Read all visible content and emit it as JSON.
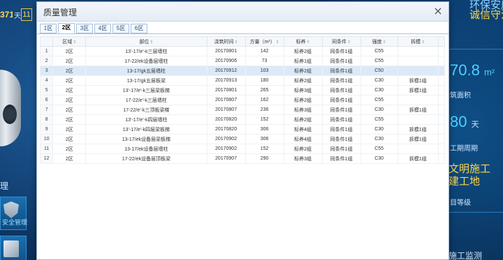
{
  "background": {
    "counter": "371",
    "day_unit": "天",
    "day_box": "11",
    "left_label": "理",
    "tile_caption": "安全管理",
    "right_title_1": "环保安康",
    "right_title_2": "诚信守法",
    "right_area_value": "70.8",
    "right_area_unit": "m²",
    "right_area_caption": "筑面积",
    "right_days_value": "80",
    "right_days_unit": "天",
    "right_days_caption": "工期周期",
    "right_civ": "文明施工\n建工地",
    "right_grade": "目等级",
    "right_monitor": "施工监测"
  },
  "modal": {
    "title": "质量管理",
    "close_label": "×",
    "tabs": [
      "1区",
      "2区",
      "3区",
      "4区",
      "5区",
      "6区"
    ],
    "active_tab": 1
  },
  "table": {
    "columns": [
      "区域",
      "部位",
      "浇筑时间",
      "方量（m³）",
      "标养",
      "同条件",
      "强度",
      "拆模"
    ],
    "rows": [
      [
        "1",
        "2区",
        "13'-17/e'-k三层墙柱",
        "20170801",
        "142",
        "标养2组",
        "同条件1组",
        "C55",
        ""
      ],
      [
        "2",
        "2区",
        "17-22/ek设备层墙柱",
        "20170906",
        "73",
        "标养1组",
        "同条件1组",
        "C55",
        ""
      ],
      [
        "3",
        "2区",
        "13-17/gk五层墙柱",
        "20170912",
        "103",
        "标养2组",
        "同条件1组",
        "C50",
        ""
      ],
      [
        "4",
        "2区",
        "13-17/gk五层板梁",
        "20170913",
        "180",
        "标养2组",
        "同条件1组",
        "C30",
        "拆模1组"
      ],
      [
        "5",
        "2区",
        "13'-17/e'-k三层梁板梯",
        "20170801",
        "265",
        "标养3组",
        "同条件1组",
        "C30",
        "拆模1组"
      ],
      [
        "6",
        "2区",
        "17-22/e'-k三层墙柱",
        "20170807",
        "162",
        "标养2组",
        "同条件1组",
        "C55",
        ""
      ],
      [
        "7",
        "2区",
        "17-22/e'-k三顶板梁梯",
        "20170807",
        "236",
        "标养3组",
        "同条件1组",
        "C30",
        "拆模1组"
      ],
      [
        "8",
        "2区",
        "13'-17/e'-k四层墙柱",
        "20170820",
        "152",
        "标养2组",
        "同条件1组",
        "C55",
        ""
      ],
      [
        "9",
        "2区",
        "13'-17/e'-k四层梁板梯",
        "20170820",
        "306",
        "标养4组",
        "同条件1组",
        "C30",
        "拆模1组"
      ],
      [
        "10",
        "2区",
        "13-17/ek设备层梁板梯",
        "20170902",
        "306",
        "标养4组",
        "同条件1组",
        "C30",
        "拆模1组"
      ],
      [
        "11",
        "2区",
        "13-17/ek设备层墙柱",
        "20170902",
        "152",
        "标养2组",
        "同条件1组",
        "C55",
        ""
      ],
      [
        "12",
        "2区",
        "17-22/ek设备层顶板梁",
        "20170907",
        "290",
        "标养3组",
        "同条件1组",
        "C30",
        "拆模1组"
      ]
    ],
    "selected_row": 2
  }
}
